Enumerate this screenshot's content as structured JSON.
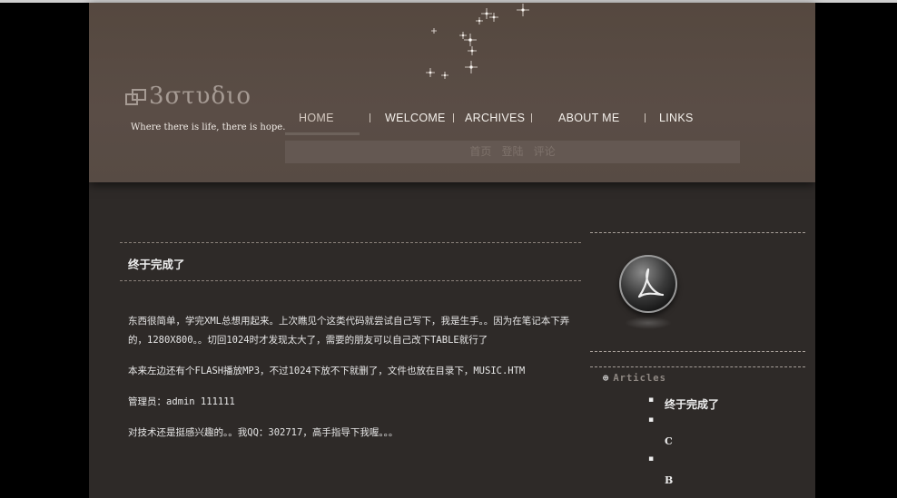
{
  "site": {
    "logo_text": "3στυδιο",
    "tagline": "Where there is life, there is hope."
  },
  "nav": {
    "items": [
      {
        "label": "HOME",
        "active": true
      },
      {
        "label": "WELCOME"
      },
      {
        "label": "ARCHIVES"
      },
      {
        "label": "ABOUT ME"
      },
      {
        "label": "LINKS"
      }
    ]
  },
  "subnav": {
    "links": [
      "首页",
      "登陆",
      "评论"
    ]
  },
  "post": {
    "title": "终于完成了",
    "paragraphs": [
      "东西很简单，学完XML总想用起来。上次瞧见个这类代码就尝试自己写下，我是生手。。因为在笔记本下弄的，1280X800。。切回1024时才发现太大了，需要的朋友可以自己改下TABLE就行了",
      "本来左边还有个FLASH播放MP3，不过1024下放不下就删了，文件也放在目录下，MUSIC.HTM",
      "管理员：admin 111111",
      "对技术还是挺感兴趣的。。我QQ：302717，高手指导下我喔。。。"
    ]
  },
  "sidebar": {
    "section_title": "Articles",
    "articles": [
      {
        "label": "终于完成了",
        "bullet": true
      },
      {
        "label": "",
        "bullet": true
      },
      {
        "label": "C",
        "bullet": false
      },
      {
        "label": "",
        "bullet": true
      },
      {
        "label": "B",
        "bullet": false
      }
    ]
  },
  "icons": {
    "pdf": "adobe-pdf-icon",
    "logo": "logo-mark-icon",
    "sparkles": "sparkle-stars-icon"
  },
  "colors": {
    "header_bg": "#574b44",
    "page_bg": "#2e2a28",
    "outer_bg": "#000000",
    "text": "#efefef"
  }
}
